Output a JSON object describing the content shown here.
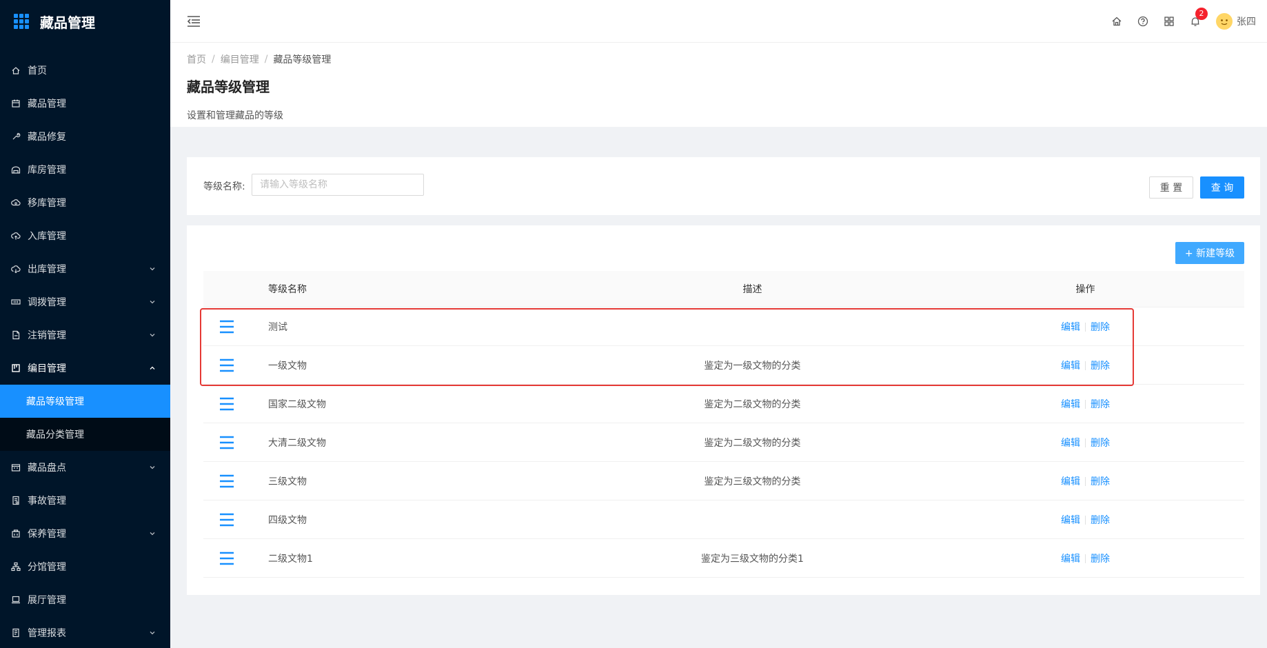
{
  "app": {
    "title": "藏品管理"
  },
  "sidebar": {
    "items": [
      {
        "label": "首页",
        "icon": "home-icon"
      },
      {
        "label": "藏品管理",
        "icon": "calendar-icon"
      },
      {
        "label": "藏品修复",
        "icon": "wrench-icon"
      },
      {
        "label": "库房管理",
        "icon": "warehouse-icon"
      },
      {
        "label": "移库管理",
        "icon": "move-icon"
      },
      {
        "label": "入库管理",
        "icon": "cloud-upload-icon"
      },
      {
        "label": "出库管理",
        "icon": "cloud-download-icon",
        "expandable": true
      },
      {
        "label": "调拨管理",
        "icon": "transfer-icon",
        "expandable": true
      },
      {
        "label": "注销管理",
        "icon": "file-icon",
        "expandable": true
      },
      {
        "label": "编目管理",
        "icon": "catalog-icon",
        "expandable": true,
        "open": true,
        "children": [
          {
            "label": "藏品等级管理",
            "active": true
          },
          {
            "label": "藏品分类管理"
          }
        ]
      },
      {
        "label": "藏品盘点",
        "icon": "inventory-icon",
        "expandable": true
      },
      {
        "label": "事故管理",
        "icon": "accident-icon"
      },
      {
        "label": "保养管理",
        "icon": "maintenance-icon",
        "expandable": true
      },
      {
        "label": "分馆管理",
        "icon": "branch-icon"
      },
      {
        "label": "展厅管理",
        "icon": "laptop-icon"
      },
      {
        "label": "管理报表",
        "icon": "report-icon",
        "expandable": true
      }
    ]
  },
  "header": {
    "notification_count": "2",
    "username": "张四",
    "accent": "#1890ff"
  },
  "page": {
    "breadcrumb": [
      "首页",
      "编目管理",
      "藏品等级管理"
    ],
    "title": "藏品等级管理",
    "description": "设置和管理藏品的等级"
  },
  "search": {
    "label": "等级名称:",
    "placeholder": "请输入等级名称",
    "value": "",
    "reset_label": "重 置",
    "query_label": "查 询"
  },
  "table": {
    "new_button_label": "+ 新建等级",
    "columns": {
      "name": "等级名称",
      "description": "描述",
      "actions": "操作"
    },
    "edit_label": "编辑",
    "delete_label": "删除",
    "rows": [
      {
        "name": "测试",
        "description": ""
      },
      {
        "name": "一级文物",
        "description": "鉴定为一级文物的分类"
      },
      {
        "name": "国家二级文物",
        "description": "鉴定为二级文物的分类"
      },
      {
        "name": "大清二级文物",
        "description": "鉴定为二级文物的分类"
      },
      {
        "name": "三级文物",
        "description": "鉴定为三级文物的分类"
      },
      {
        "name": "四级文物",
        "description": ""
      },
      {
        "name": "二级文物1",
        "description": "鉴定为三级文物的分类1"
      }
    ]
  }
}
